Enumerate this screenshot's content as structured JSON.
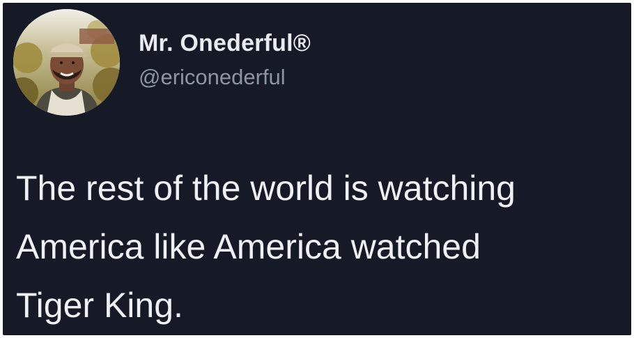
{
  "tweet": {
    "author": {
      "display_name": "Mr. Onederful®",
      "handle": "@ericonederful",
      "avatar_icon": "profile-photo"
    },
    "text_lines": [
      "The rest of the world is watching",
      "America like America watched",
      "Tiger King."
    ]
  },
  "colors": {
    "card_background": "#161a26",
    "name_text": "#e8ebef",
    "handle_text": "#8c96a2",
    "body_text": "#eef0f3"
  }
}
